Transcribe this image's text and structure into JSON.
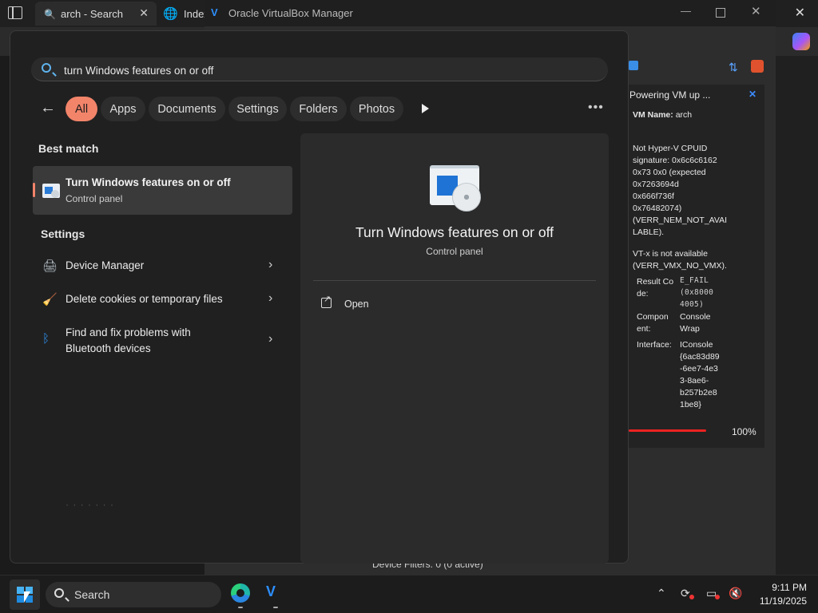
{
  "browser": {
    "tab1_title": "arch - Search",
    "tab2_title": "Index"
  },
  "vbox": {
    "window_title": "Oracle VirtualBox Manager",
    "notification": {
      "title": "Powering VM up ...",
      "vm_name_label": "VM Name:",
      "vm_name": "arch",
      "error1_lines": [
        "Not Hyper-V CPUID",
        "signature: 0x6c6c6162",
        "0x73 0x0 (expected",
        "0x7263694d",
        "0x666f736f",
        "0x76482074)",
        "(VERR_NEM_NOT_AVAI",
        "LABLE)."
      ],
      "error2_lines": [
        "VT-x is not available",
        "(VERR_VMX_NO_VMX)."
      ],
      "result_code_label_lines": [
        "Result Co",
        "de:"
      ],
      "result_code_value_lines": [
        "E_FAIL",
        "(0x8000",
        "4005)"
      ],
      "component_label_lines": [
        "Compon",
        "ent:"
      ],
      "component_value_lines": [
        "Console",
        "Wrap"
      ],
      "interface_label": "Interface:",
      "interface_value_lines": [
        "IConsole",
        "{6ac83d89",
        "-6ee7-4e3",
        "3-8ae6-",
        "b257b2e8",
        "1be8}"
      ]
    },
    "progress_percent": "100%",
    "progress_value": 1.0,
    "bottom_text": "Device Filters:      0 (0 active)"
  },
  "search": {
    "query": "turn Windows features on or off",
    "filters": [
      "All",
      "Apps",
      "Documents",
      "Settings",
      "Folders",
      "Photos"
    ],
    "active_filter": "All",
    "best_match_heading": "Best match",
    "best_match": {
      "title": "Turn Windows features on or off",
      "subtitle": "Control panel"
    },
    "settings_heading": "Settings",
    "settings_items": [
      {
        "label_lines": [
          "Device Manager"
        ],
        "icon": "device-manager-icon"
      },
      {
        "label_lines": [
          "Delete cookies or temporary files"
        ],
        "icon": "cleanup-icon"
      },
      {
        "label_lines": [
          "Find and fix problems with",
          "Bluetooth devices"
        ],
        "icon": "bluetooth-icon"
      }
    ],
    "detail": {
      "title": "Turn Windows features on or off",
      "subtitle": "Control panel",
      "open_label": "Open"
    }
  },
  "taskbar": {
    "search_label": "Search",
    "time": "9:11 PM",
    "date": "11/19/2025"
  },
  "colors": {
    "accent": "#f2846a",
    "progress": "#ee2222",
    "panel_bg": "#202020"
  }
}
